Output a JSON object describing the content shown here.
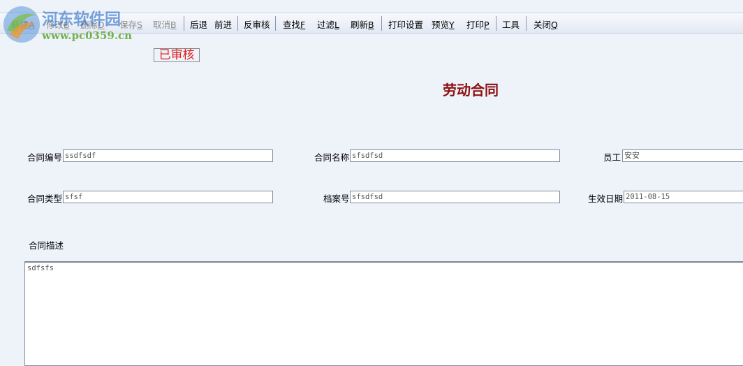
{
  "watermark": {
    "name": "河东软件园",
    "url": "www.pc0359.cn"
  },
  "toolbar": {
    "new": {
      "text": "新建",
      "key": "A"
    },
    "modify": {
      "text": "修改",
      "key": "B"
    },
    "delete": {
      "text": "删除",
      "key": "D"
    },
    "save": {
      "text": "保存",
      "key": "S"
    },
    "cancel": {
      "text": "取消",
      "key": "B"
    },
    "back": {
      "text": "后退"
    },
    "forward": {
      "text": "前进"
    },
    "unaudit": {
      "text": "反审核"
    },
    "find": {
      "text": "查找",
      "key": "F"
    },
    "filter": {
      "text": "过滤",
      "key": "L"
    },
    "refresh": {
      "text": "刷新",
      "key": "B"
    },
    "print_settings": {
      "text": "打印设置"
    },
    "preview": {
      "text": "预览",
      "key": "Y"
    },
    "print": {
      "text": "打印",
      "key": "P"
    },
    "tools": {
      "text": "工具"
    },
    "close": {
      "text": "关闭",
      "key": "Q"
    }
  },
  "status_stamp": "已审核",
  "form_title": "劳动合同",
  "fields": {
    "contract_no": {
      "label": "合同编号",
      "value": "ssdfsdf"
    },
    "contract_name": {
      "label": "合同名称",
      "value": "sfsdfsd"
    },
    "employee": {
      "label": "员工",
      "value": "安安"
    },
    "contract_type": {
      "label": "合同类型",
      "value": "sfsf"
    },
    "file_no": {
      "label": "档案号",
      "value": "sfsdfsd"
    },
    "effective_date": {
      "label": "生效日期",
      "value": "2011-08-15"
    }
  },
  "description": {
    "label": "合同描述",
    "value": "sdfsfs"
  }
}
